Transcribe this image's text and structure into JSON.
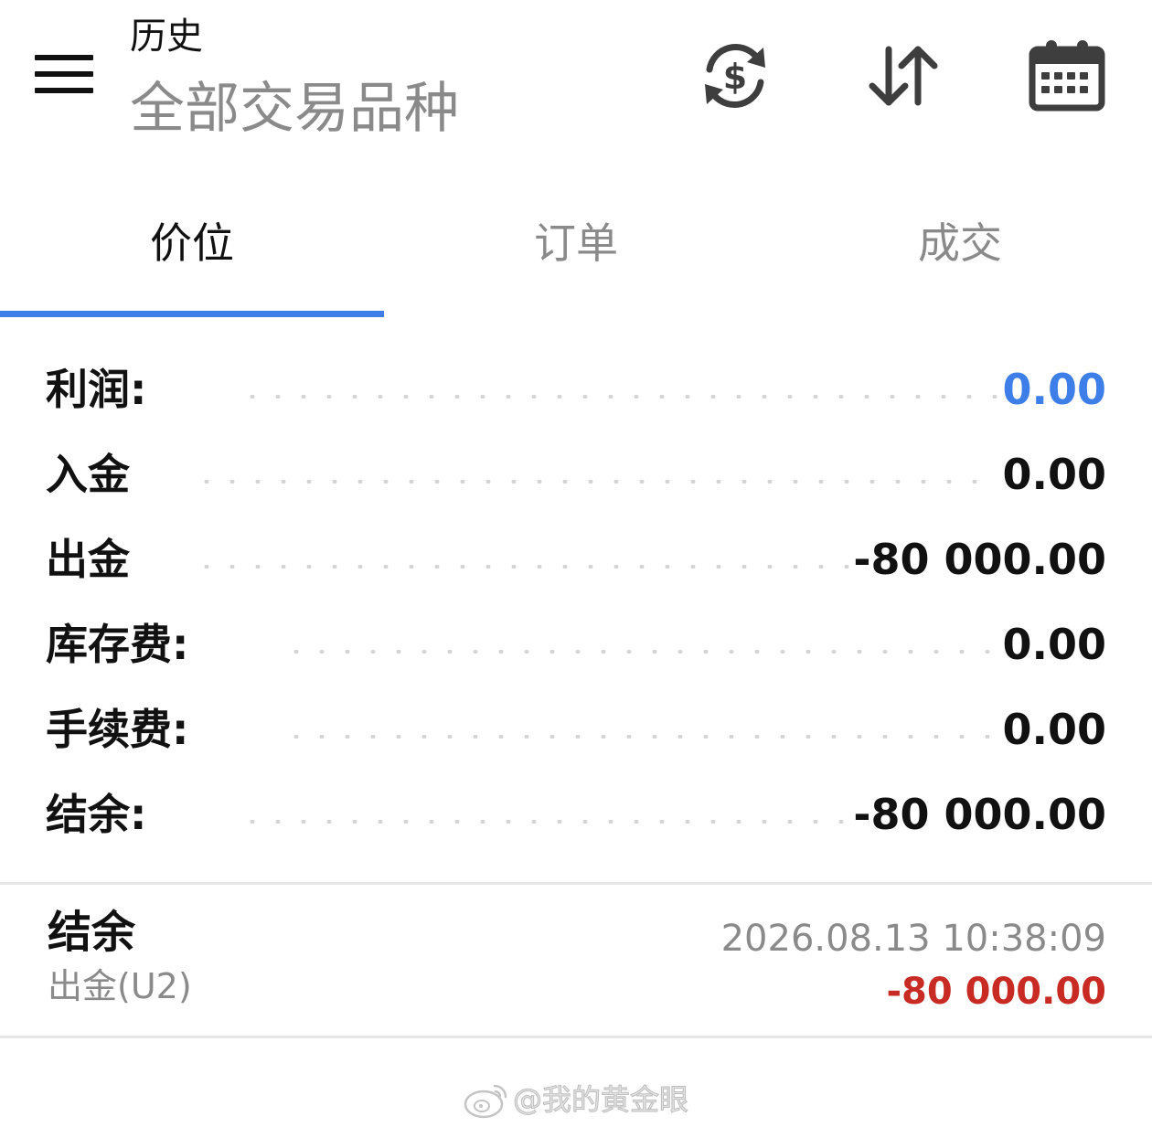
{
  "header": {
    "title": "历史",
    "subtitle": "全部交易品种",
    "icons": [
      "menu-icon",
      "currency-exchange-icon",
      "sort-icon",
      "calendar-icon"
    ]
  },
  "tabs": [
    {
      "label": "价位",
      "active": true
    },
    {
      "label": "订单",
      "active": false
    },
    {
      "label": "成交",
      "active": false
    }
  ],
  "summary": [
    {
      "label": "利润:",
      "value": "0.00",
      "color": "#3e7ee8"
    },
    {
      "label": "入金",
      "value": "0.00"
    },
    {
      "label": "出金",
      "value": "-80 000.00"
    },
    {
      "label": "库存费:",
      "value": "0.00"
    },
    {
      "label": "手续费:",
      "value": "0.00"
    },
    {
      "label": "结余:",
      "value": "-80 000.00"
    }
  ],
  "deals": [
    {
      "type": "结余",
      "comment": "出金(U2)",
      "time": "2026.08.13 10:38:09",
      "amount": "-80 000.00",
      "amount_color": "#c72b24"
    }
  ],
  "watermark": {
    "text": "@我的黄金眼",
    "icon": "weibo-logo-icon"
  },
  "colors": {
    "accent": "#3e7ee8",
    "negative": "#c72b24",
    "muted_text": "#8a8a8a"
  }
}
